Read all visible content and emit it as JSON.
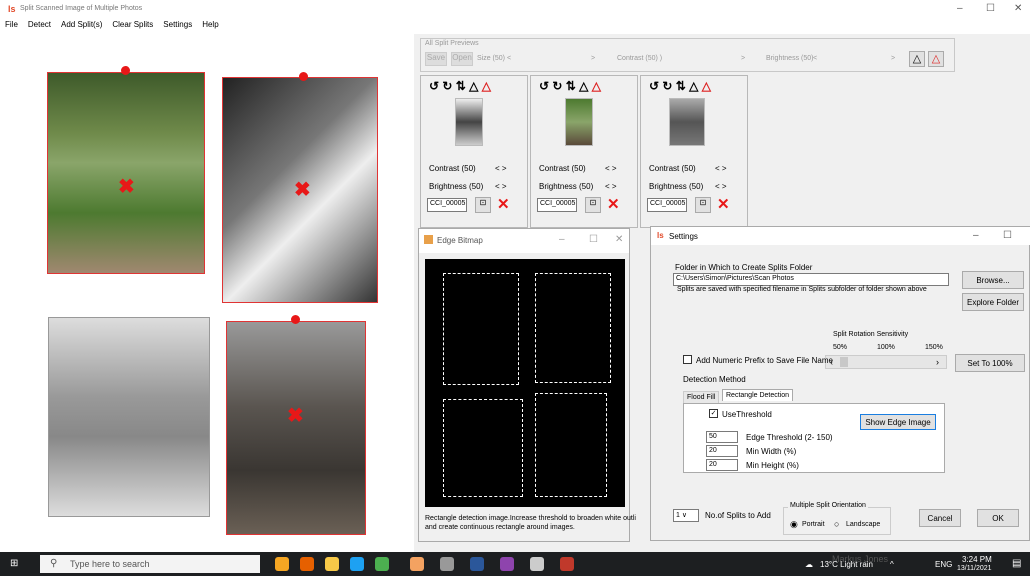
{
  "app": {
    "title": "Split Scanned Image of Multiple Photos",
    "logo": "ls"
  },
  "window_controls": [
    "–",
    "☐",
    "✕"
  ],
  "menu": [
    "File",
    "Detect",
    "Add Split(s)",
    "Clear Splits",
    "Settings",
    "Help"
  ],
  "previews": {
    "group_label": "All Split Previews",
    "save": "Save",
    "open": "Open",
    "size": "Size (50)",
    "contrast": "Contrast (50) )",
    "brightness": "Brightness (50)",
    "left": "<",
    "right": ">",
    "upright_icon": "delta-icon",
    "flip_icon": "delta-x-icon"
  },
  "split_panels": [
    {
      "contrast": "Contrast (50)",
      "brightness": "Brightness (50)",
      "name": "CCI_00005",
      "arrows": "< >"
    },
    {
      "contrast": "Contrast (50)",
      "brightness": "Brightness (50)",
      "name": "CCI_00005",
      "arrows": "< >"
    },
    {
      "contrast": "Contrast (50)",
      "brightness": "Brightness (50)",
      "name": "CCI_00005",
      "arrows": "< >"
    }
  ],
  "edge_window": {
    "title": "Edge Bitmap",
    "caption_line1": "Rectangle detection image.Increase threshold to broaden white outli",
    "caption_line2": "and create continuous rectangle around images."
  },
  "settings": {
    "title": "Settings",
    "folder_label": "Folder in Which to Create Splits Folder",
    "folder_value": "C:\\Users\\Simon\\Pictures\\Scan Photos",
    "folder_note": "Splits are saved with specified filename in Splits subfolder of folder shown above",
    "browse": "Browse...",
    "explore": "Explore Folder",
    "rotation_label": "Split Rotation Sensitivity",
    "ticks": [
      "50%",
      "100%",
      "150%"
    ],
    "set100": "Set To 100%",
    "numeric_prefix": "Add Numeric Prefix to Save File Name",
    "detection_method": "Detection Method",
    "tabs": [
      "Flood Fill",
      "Rectangle Detection"
    ],
    "use_threshold": "UseThreshold",
    "show_edge": "Show Edge Image",
    "edge_threshold_val": "50",
    "edge_threshold_lbl": "Edge Threshold (2- 150)",
    "min_width_val": "20",
    "min_width_lbl": "Min Width (%)",
    "min_height_val": "20",
    "min_height_lbl": "Min Height (%)",
    "splits_count": "1",
    "splits_lbl": "No.of Splits to Add",
    "orientation_lbl": "Multiple Split Orientation",
    "portrait": "Portrait",
    "landscape": "Landscape",
    "cancel": "Cancel",
    "ok": "OK"
  },
  "taskbar": {
    "search": "Type here to search",
    "weather": "13°C  Light rain",
    "lang": "ENG",
    "time": "3:24 PM",
    "date": "13/11/2021",
    "watermark": "Markus Jones"
  }
}
